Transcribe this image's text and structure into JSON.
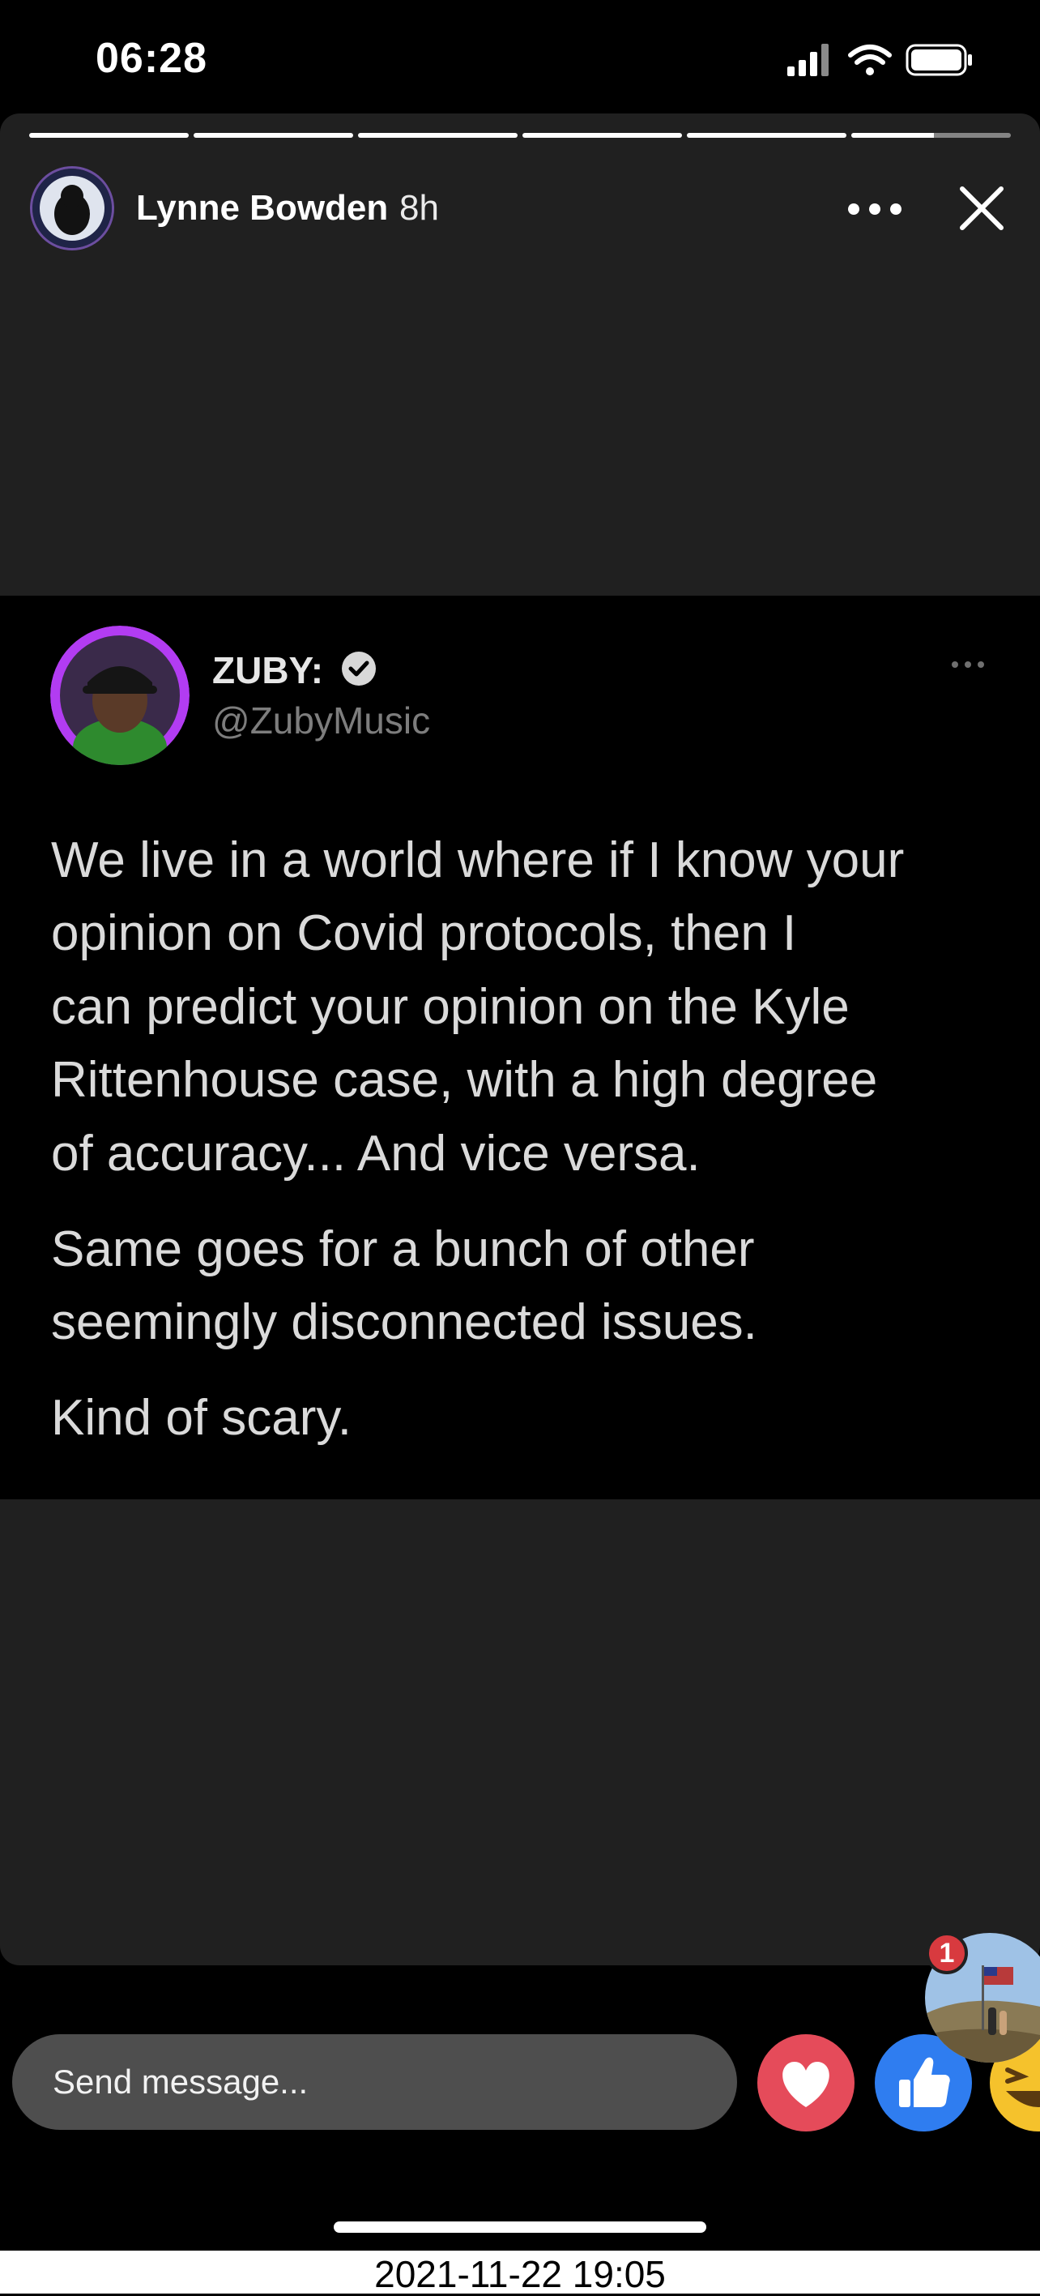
{
  "status_bar": {
    "time": "06:28",
    "icons": [
      "signal-icon",
      "wifi-icon",
      "battery-icon"
    ]
  },
  "story": {
    "poster_name": "Lynne Bowden",
    "posted_ago": "8h",
    "segments_total": 6,
    "segment_progress": [
      1,
      1,
      1,
      1,
      1,
      0.52
    ],
    "tweet": {
      "name": "ZUBY:",
      "handle": "@ZubyMusic",
      "lines": [
        "We live in a world where if I know your",
        "opinion on Covid protocols, then I",
        "can predict your opinion on the Kyle",
        "Rittenhouse case, with a high degree",
        "of accuracy... And vice versa.",
        "Same goes for a bunch of other",
        "seemingly disconnected issues.",
        "Kind of scary."
      ]
    }
  },
  "reply_bar": {
    "placeholder": "Send message...",
    "reactions": [
      "heart-icon",
      "thumbs-up-icon",
      "haha-icon"
    ],
    "viewer_badge": "1"
  },
  "footer": {
    "timestamp": "2021-11-22 19:05"
  },
  "colors": {
    "background": "#000000",
    "card": "#202020",
    "heart": "#e54b5a",
    "like": "#2f7df0",
    "badge": "#d83a3f"
  }
}
